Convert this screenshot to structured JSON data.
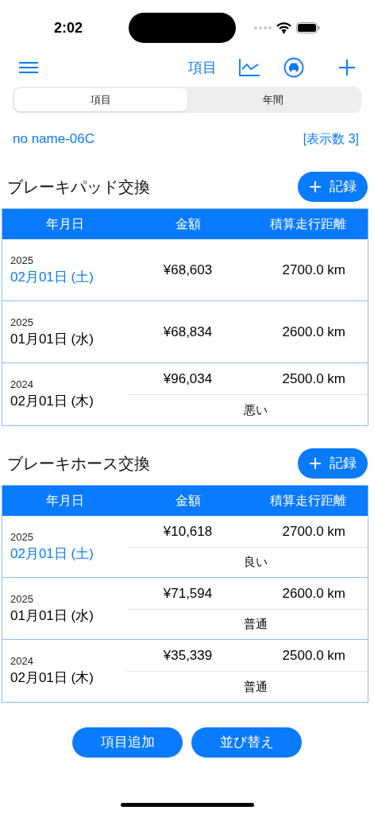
{
  "status_bar": {
    "time": "2:02"
  },
  "toolbar": {
    "title_button": "項目"
  },
  "segments": [
    {
      "label": "項目",
      "selected": true
    },
    {
      "label": "年間",
      "selected": false
    }
  ],
  "vehicle": {
    "name": "no name-06C",
    "count": "[表示数 3]"
  },
  "sections": [
    {
      "title": "ブレーキパッド交換",
      "record_button": "記録",
      "columns": [
        "年月日",
        "金額",
        "積算走行距離"
      ],
      "rows": [
        {
          "year": "2025",
          "date": "02月01日 (土)",
          "color": "#0a7aff",
          "amount": "¥68,603",
          "distance": "2700.0 km"
        },
        {
          "year": "2025",
          "date": "01月01日 (水)",
          "color": "#000000",
          "amount": "¥68,834",
          "distance": "2600.0 km"
        },
        {
          "year": "2024",
          "date": "02月01日 (木)",
          "color": "#000000",
          "amount": "¥96,034",
          "distance": "2500.0 km",
          "note": "悪い"
        }
      ]
    },
    {
      "title": "ブレーキホース交換",
      "record_button": "記録",
      "columns": [
        "年月日",
        "金額",
        "積算走行距離"
      ],
      "rows": [
        {
          "year": "2025",
          "date": "02月01日 (土)",
          "color": "#0a7aff",
          "amount": "¥10,618",
          "distance": "2700.0 km",
          "note": "良い"
        },
        {
          "year": "2025",
          "date": "01月01日 (水)",
          "color": "#000000",
          "amount": "¥71,594",
          "distance": "2600.0 km",
          "note": "普通"
        },
        {
          "year": "2024",
          "date": "02月01日 (木)",
          "color": "#000000",
          "amount": "¥35,339",
          "distance": "2500.0 km",
          "note": "普通"
        }
      ]
    }
  ],
  "bottom_buttons": [
    "項目追加",
    "並び替え"
  ]
}
